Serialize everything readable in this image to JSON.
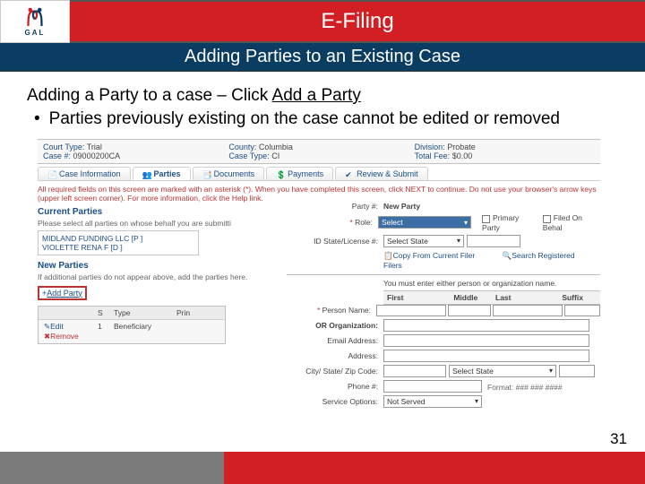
{
  "logo": {
    "text": "GAL"
  },
  "header": {
    "title": "E-Filing"
  },
  "subheader": {
    "title": "Adding Parties to an Existing Case"
  },
  "instruction": {
    "line1a": "Adding a Party to a case – Click ",
    "line1b": "Add a Party",
    "bullet": "Parties previously existing on the case cannot be edited or removed"
  },
  "caseHeader": {
    "courtTypeLabel": "Court Type:",
    "courtType": "Trial",
    "caseNumLabel": "Case #:",
    "caseNum": "09000200CA",
    "countyLabel": "County:",
    "county": "Columbia",
    "caseTypeLabel": "Case Type:",
    "caseType": "CI",
    "divisionLabel": "Division:",
    "division": "Probate",
    "totalFeeLabel": "Total Fee:",
    "totalFee": "$0.00"
  },
  "tabs": {
    "caseInfo": "Case Information",
    "parties": "Parties",
    "documents": "Documents",
    "payments": "Payments",
    "review": "Review & Submit"
  },
  "notice": "All required fields on this screen are marked with an asterisk (*). When you have completed this screen, click NEXT to continue. Do not use your browser's arrow keys (upper left screen corner). For more information, click the Help link.",
  "currentParties": {
    "title": "Current Parties",
    "hint": "Please select all parties on whose behalf you are submitti",
    "p1": "MIDLAND FUNDING LLC  [P ]",
    "p2": "VIOLETTE RENA F  [D ]"
  },
  "newParties": {
    "title": "New Parties",
    "hint": "If additional parties do not appear above, add the parties here.",
    "addLabelPrefix": "+",
    "addLabel": "Add Party"
  },
  "grid": {
    "col_s": "S",
    "col_type": "Type",
    "col_prin": "Prin",
    "edit": "Edit",
    "remove": "Remove",
    "rownum": "1",
    "rowtype": "Beneficiary"
  },
  "rp": {
    "partyNumLabel": "Party #:",
    "partyNum": "New Party",
    "roleLabel": "Role:",
    "roleValue": "Select",
    "primary": "Primary Party",
    "filedOn": "Filed On Behal",
    "idLabel": "ID State/License #:",
    "idValue": "Select State",
    "copy": "Copy From Current Filer",
    "search": "Search Registered Filers",
    "instr": "You must enter either person or organization name.",
    "first": "First",
    "middle": "Middle",
    "last": "Last",
    "suffix": "Suffix",
    "personLabel": "Person Name:",
    "orLabel": "OR Organization:",
    "emailLabel": "Email Address:",
    "addrLabel": "Address:",
    "cityLabel": "City/ State/ Zip Code:",
    "stateSel": "Select State",
    "phoneLabel": "Phone #:",
    "phoneFmt": "Format: ### ### ####",
    "serviceLabel": "Service Options:",
    "serviceVal": "Not Served"
  },
  "pageNumber": "31"
}
